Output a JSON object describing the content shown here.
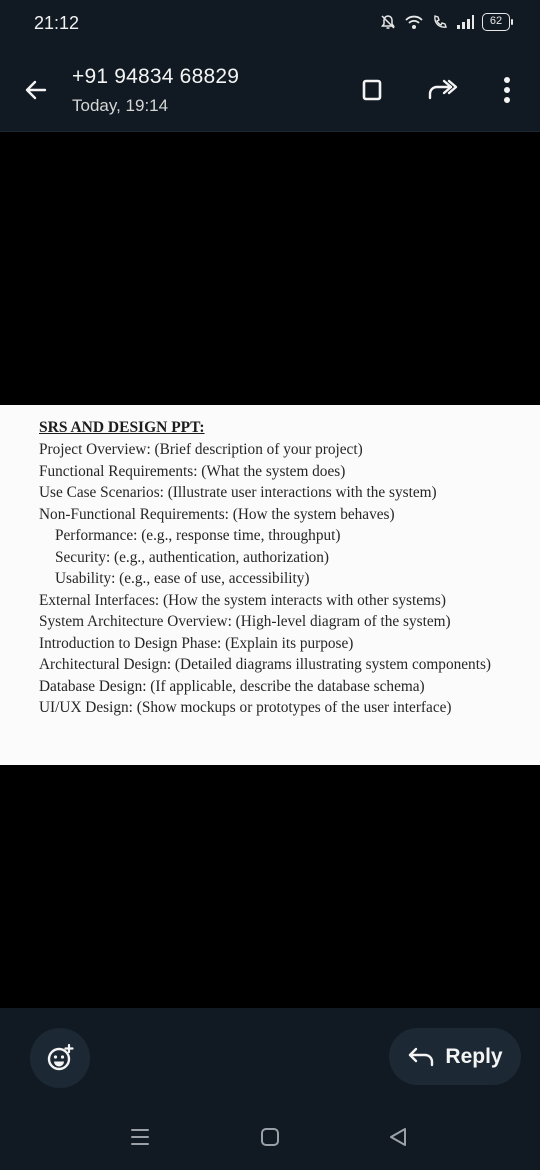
{
  "status_bar": {
    "time": "21:12",
    "battery": "62",
    "icons": [
      "mute-icon",
      "wifi-icon",
      "wifi-call-icon",
      "signal-icon",
      "battery-icon"
    ]
  },
  "header": {
    "contact": "+91 94834 68829",
    "subtitle": "Today, 19:14",
    "icons": [
      "back-arrow-icon",
      "bookmark-icon",
      "forward-icon",
      "more-vertical-icon"
    ]
  },
  "document": {
    "title": "SRS AND DESIGN PPT:",
    "lines": [
      {
        "text": "Project Overview: (Brief description of your project)"
      },
      {
        "text": "Functional Requirements: (What the system does)"
      },
      {
        "text": "Use Case Scenarios: (Illustrate user interactions with the system)"
      },
      {
        "text": "Non-Functional Requirements: (How the system behaves)"
      },
      {
        "text": "Performance: (e.g., response time, throughput)",
        "indent": true
      },
      {
        "text": "Security: (e.g., authentication, authorization)",
        "indent": true
      },
      {
        "text": "Usability: (e.g., ease of use, accessibility)",
        "indent": true
      },
      {
        "text": "External Interfaces: (How the system interacts with other systems)"
      },
      {
        "text": "System Architecture Overview: (High-level diagram of the system)"
      },
      {
        "text": "Introduction to Design Phase: (Explain its purpose)"
      },
      {
        "text": "Architectural Design: (Detailed diagrams illustrating system components)"
      },
      {
        "text": "Database Design: (If applicable, describe the database schema)"
      },
      {
        "text": "UI/UX Design: (Show mockups or prototypes of the user interface)"
      }
    ]
  },
  "actions": {
    "reply_label": "Reply",
    "icons": [
      "emoji-add-icon",
      "reply-arrow-icon"
    ]
  },
  "nav_bar": {
    "icons": [
      "recents-icon",
      "home-icon",
      "back-icon"
    ]
  },
  "colors": {
    "bar_background": "#111a22",
    "button_background": "#1c2833",
    "text": "#f4f4f4"
  }
}
